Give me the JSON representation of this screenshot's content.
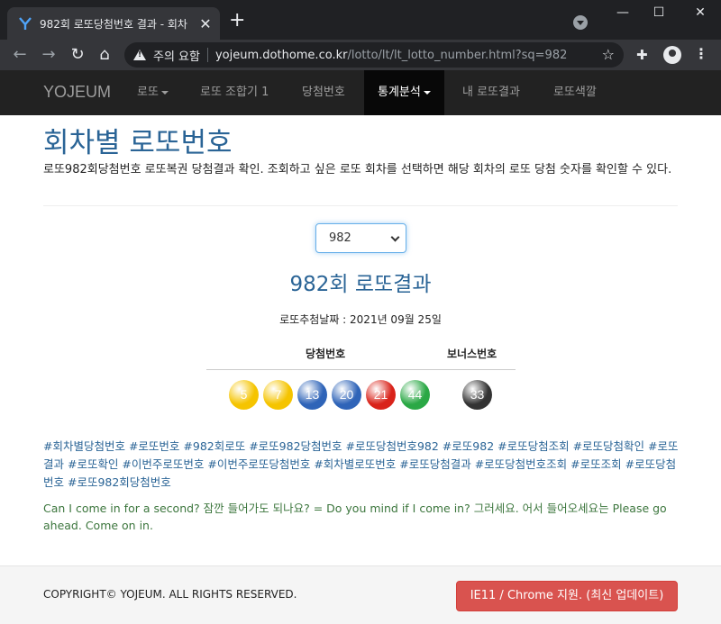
{
  "browser": {
    "tab_title": "982회 로또당첨번호 결과 - 회차",
    "security_label": "주의 요함",
    "url_host": "yojeum.dothome.co.kr",
    "url_path": "/lotto/lt/lt_lotto_number.html?sq=982"
  },
  "navbar": {
    "brand": "YOJEUM",
    "items": [
      {
        "label": "로또",
        "dropdown": true
      },
      {
        "label": "로또 조합기 1",
        "dropdown": false
      },
      {
        "label": "당첨번호",
        "dropdown": false
      },
      {
        "label": "통계분석",
        "dropdown": true,
        "active": true
      },
      {
        "label": "내 로또결과",
        "dropdown": false
      },
      {
        "label": "로또색깔",
        "dropdown": false
      }
    ]
  },
  "page": {
    "title": "회차별 로또번호",
    "description": "로또982회당첨번호 로또복권 당첨결과 확인. 조회하고 싶은 로또 회차를 선택하면 해당 회차의 로또 당첨 숫자를 확인할 수 있다.",
    "select_value": "982",
    "result_title": "982회 로또결과",
    "draw_date": "로또추첨날짜 : 2021년 09월 25일",
    "winning_header": "당첨번호",
    "bonus_header": "보너스번호",
    "winning_numbers": [
      "5",
      "7",
      "13",
      "20",
      "21",
      "44"
    ],
    "bonus_number": "33",
    "hashtags": "#회차별당첨번호 #로또번호 #982회로또 #로또982당첨번호 #로또당첨번호982 #로또982 #로또당첨조회 #로또당첨확인 #로또결과 #로또확인 #이번주로또번호 #이번주로또당첨번호 #회차별로또번호 #로또당첨결과 #로또당첨번호조회 #로또조회 #로또당첨번호 #로또982회당첨번호",
    "dialog": "Can I come in for a second? 잠깐 들어가도 되나요? = Do you mind if I come in? 그러세요. 어서 들어오세요는 Please go ahead. Come on in."
  },
  "ball_colors": {
    "yellow": "#f5c400",
    "blue": "#2f64b8",
    "red": "#d9231a",
    "green": "#2aa845",
    "gray": "#333333"
  },
  "footer": {
    "copyright": "COPYRIGHT© YOJEUM. ALL RIGHTS RESERVED.",
    "browser_button": "IE11 / Chrome 지원. (최신 업데이트)"
  }
}
